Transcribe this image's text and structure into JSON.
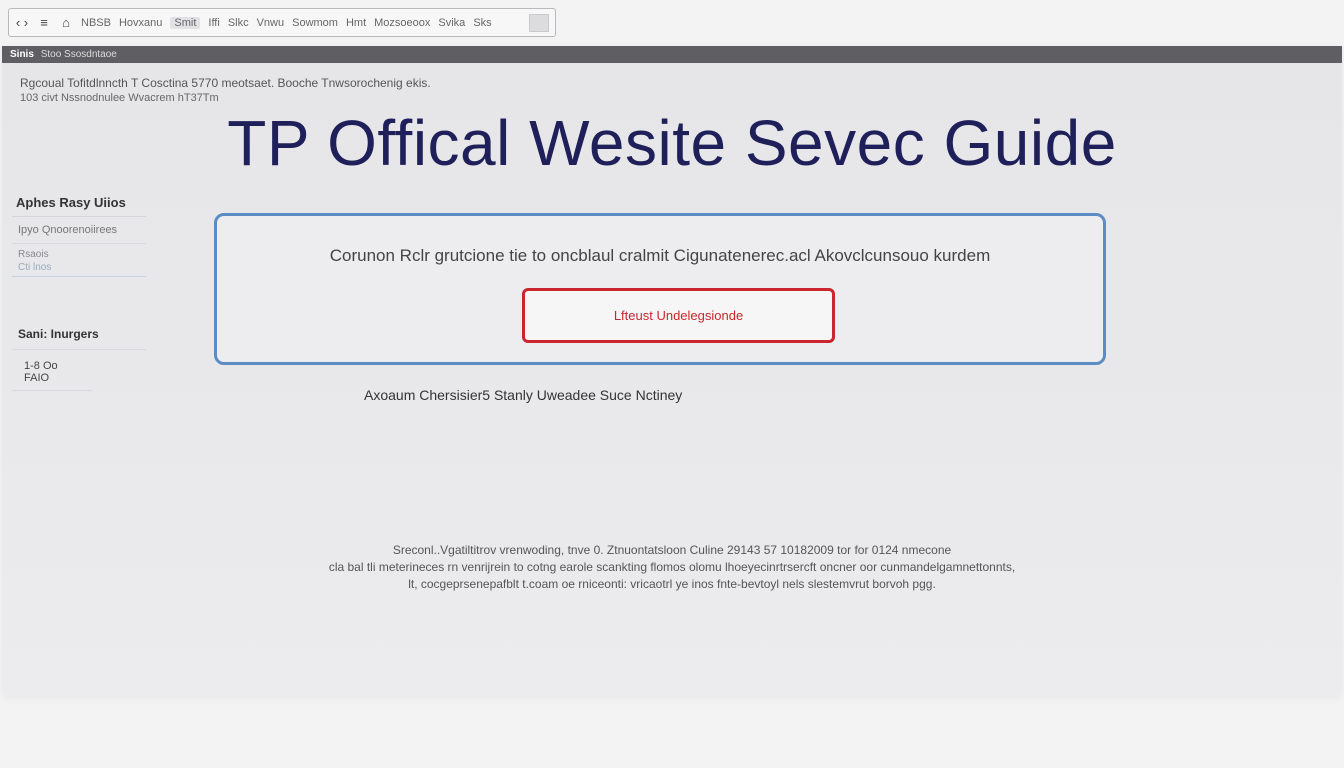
{
  "toolbar": {
    "items": [
      {
        "label": "‹ ›",
        "icon": "back-forward-icon"
      },
      {
        "label": "≡",
        "icon": "menu-icon"
      },
      {
        "label": "⌂",
        "icon": "home-icon"
      }
    ],
    "links": [
      "NBSB",
      "Hovxanu",
      "Smit",
      "Iffi",
      "Slkc",
      "Vnwu",
      "Sowmom",
      "Hmt",
      "Mozsoeoox",
      "Svika",
      "Sks"
    ]
  },
  "window": {
    "title_bold": "Sinis",
    "title_rest": "Stoo Ssosdntaoe"
  },
  "subhead": {
    "line1": "Rgcoual Tofitdlnncth T Cosctina 5770 meotsaet. Booche Tnwsorochenig ekis.",
    "line2": "103 civt Nssnodnulee Wvacrem hT37Tm"
  },
  "page_title": "TP Offical Wesite Sevec Guide",
  "sidebar": {
    "section1_title": "Aphes Rasy Uiios",
    "item1": "Ipyo Qnoorenoiirees",
    "item2": "Rsaois",
    "item2_sub": "Cti lnos",
    "section2_title": "Sani: Inurgers",
    "item3": "1-8 Oo FAIO"
  },
  "panel": {
    "prompt": "Corunon Rclr grutcione tie to oncblaul cralmit Cigunatenerec.acl Akovclcunsouo kurdem",
    "cta_label": "Lfteust Undelegsionde"
  },
  "caption": "Axoaum Chersisier5 Stanly Uweadee Suce Nctiney",
  "footer": {
    "line1": "Sreconl..Vgatiltitrov vrenwoding, tnve 0. Ztnuontatsloon Culine 29143 57 10182009 tor for 0124 nmecone",
    "line2": "cla bal tli meterineces rn venrijrein to cotng earole scankting flomos olomu lhoeyecinrtrsercft oncner oor cunmandelgamnettonnts,",
    "line3": "lt, cocgeprsenepafblt t.coam oe rniceonti: vricaotrl ye inos fnte-bevtoyl nels slestemvrut borvoh pgg."
  }
}
